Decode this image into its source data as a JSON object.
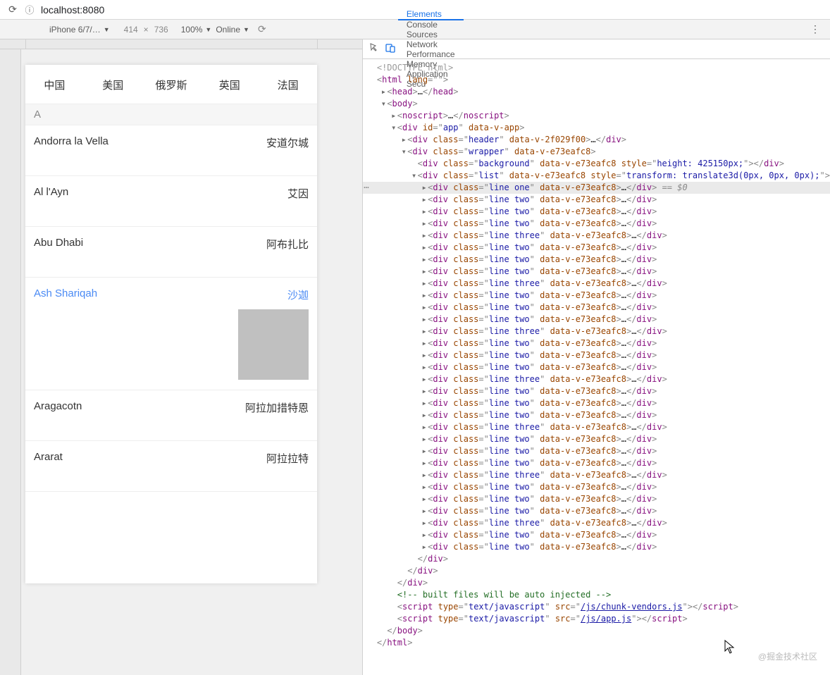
{
  "url": "localhost:8080",
  "device": {
    "name": "iPhone 6/7/…",
    "w": "414",
    "h": "736",
    "zoom": "100%",
    "online": "Online"
  },
  "dtTabs": [
    "Elements",
    "Console",
    "Sources",
    "Network",
    "Performance",
    "Memory",
    "Application",
    "Secu"
  ],
  "phone": {
    "tabs": [
      "中国",
      "美国",
      "俄罗斯",
      "英国",
      "法国"
    ],
    "section": "A",
    "rows": [
      {
        "en": "Andorra la Vella",
        "cn": "安道尔城"
      },
      {
        "en": "Al l'Ayn",
        "cn": "艾因"
      },
      {
        "en": "Abu Dhabi",
        "cn": "阿布扎比"
      },
      {
        "en": "Ash Shariqah",
        "cn": "沙迦",
        "active": true
      },
      {
        "en": "Aragacotn",
        "cn": "阿拉加措特恩"
      },
      {
        "en": "Ararat",
        "cn": "阿拉拉特"
      }
    ]
  },
  "tree": [
    {
      "d": 0,
      "c": "",
      "raw": "doctype"
    },
    {
      "d": 0,
      "c": "",
      "open": "html",
      "attrs": [
        [
          "lang",
          ""
        ]
      ],
      "selfc": false,
      "noKids": true
    },
    {
      "d": 1,
      "c": "▸",
      "open": "head",
      "dots": true,
      "close": "head"
    },
    {
      "d": 1,
      "c": "▾",
      "open": "body"
    },
    {
      "d": 2,
      "c": "▸",
      "open": "noscript",
      "dots": true,
      "close": "noscript"
    },
    {
      "d": 2,
      "c": "▾",
      "open": "div",
      "attrs": [
        [
          "id",
          "app"
        ],
        [
          "data-v-app",
          null
        ]
      ]
    },
    {
      "d": 3,
      "c": "▸",
      "open": "div",
      "attrs": [
        [
          "class",
          "header"
        ],
        [
          "data-v-2f029f00",
          null
        ]
      ],
      "dots": true,
      "close": "div"
    },
    {
      "d": 3,
      "c": "▾",
      "open": "div",
      "attrs": [
        [
          "class",
          "wrapper"
        ],
        [
          "data-v-e73eafc8",
          null
        ]
      ]
    },
    {
      "d": 4,
      "c": "",
      "open": "div",
      "attrs": [
        [
          "class",
          "background"
        ],
        [
          "data-v-e73eafc8",
          null
        ],
        [
          "style",
          "height: 425150px;"
        ]
      ],
      "close": "div"
    },
    {
      "d": 4,
      "c": "▾",
      "open": "div",
      "attrs": [
        [
          "class",
          "list"
        ],
        [
          "data-v-e73eafc8",
          null
        ],
        [
          "style",
          "transform: translate3d(0px, 0px, 0px);"
        ]
      ]
    },
    {
      "d": 5,
      "c": "▸",
      "hl": true,
      "open": "div",
      "attrs": [
        [
          "class",
          "line one"
        ],
        [
          "data-v-e73eafc8",
          null
        ]
      ],
      "dots": true,
      "close": "div",
      "sel": " == $0"
    },
    {
      "d": 5,
      "c": "▸",
      "open": "div",
      "attrs": [
        [
          "class",
          "line two"
        ],
        [
          "data-v-e73eafc8",
          null
        ]
      ],
      "dots": true,
      "close": "div"
    },
    {
      "d": 5,
      "c": "▸",
      "open": "div",
      "attrs": [
        [
          "class",
          "line two"
        ],
        [
          "data-v-e73eafc8",
          null
        ]
      ],
      "dots": true,
      "close": "div"
    },
    {
      "d": 5,
      "c": "▸",
      "open": "div",
      "attrs": [
        [
          "class",
          "line two"
        ],
        [
          "data-v-e73eafc8",
          null
        ]
      ],
      "dots": true,
      "close": "div"
    },
    {
      "d": 5,
      "c": "▸",
      "open": "div",
      "attrs": [
        [
          "class",
          "line three"
        ],
        [
          "data-v-e73eafc8",
          null
        ]
      ],
      "dots": true,
      "close": "div"
    },
    {
      "d": 5,
      "c": "▸",
      "open": "div",
      "attrs": [
        [
          "class",
          "line two"
        ],
        [
          "data-v-e73eafc8",
          null
        ]
      ],
      "dots": true,
      "close": "div"
    },
    {
      "d": 5,
      "c": "▸",
      "open": "div",
      "attrs": [
        [
          "class",
          "line two"
        ],
        [
          "data-v-e73eafc8",
          null
        ]
      ],
      "dots": true,
      "close": "div"
    },
    {
      "d": 5,
      "c": "▸",
      "open": "div",
      "attrs": [
        [
          "class",
          "line two"
        ],
        [
          "data-v-e73eafc8",
          null
        ]
      ],
      "dots": true,
      "close": "div"
    },
    {
      "d": 5,
      "c": "▸",
      "open": "div",
      "attrs": [
        [
          "class",
          "line three"
        ],
        [
          "data-v-e73eafc8",
          null
        ]
      ],
      "dots": true,
      "close": "div"
    },
    {
      "d": 5,
      "c": "▸",
      "open": "div",
      "attrs": [
        [
          "class",
          "line two"
        ],
        [
          "data-v-e73eafc8",
          null
        ]
      ],
      "dots": true,
      "close": "div"
    },
    {
      "d": 5,
      "c": "▸",
      "open": "div",
      "attrs": [
        [
          "class",
          "line two"
        ],
        [
          "data-v-e73eafc8",
          null
        ]
      ],
      "dots": true,
      "close": "div"
    },
    {
      "d": 5,
      "c": "▸",
      "open": "div",
      "attrs": [
        [
          "class",
          "line two"
        ],
        [
          "data-v-e73eafc8",
          null
        ]
      ],
      "dots": true,
      "close": "div"
    },
    {
      "d": 5,
      "c": "▸",
      "open": "div",
      "attrs": [
        [
          "class",
          "line three"
        ],
        [
          "data-v-e73eafc8",
          null
        ]
      ],
      "dots": true,
      "close": "div"
    },
    {
      "d": 5,
      "c": "▸",
      "open": "div",
      "attrs": [
        [
          "class",
          "line two"
        ],
        [
          "data-v-e73eafc8",
          null
        ]
      ],
      "dots": true,
      "close": "div"
    },
    {
      "d": 5,
      "c": "▸",
      "open": "div",
      "attrs": [
        [
          "class",
          "line two"
        ],
        [
          "data-v-e73eafc8",
          null
        ]
      ],
      "dots": true,
      "close": "div"
    },
    {
      "d": 5,
      "c": "▸",
      "open": "div",
      "attrs": [
        [
          "class",
          "line two"
        ],
        [
          "data-v-e73eafc8",
          null
        ]
      ],
      "dots": true,
      "close": "div"
    },
    {
      "d": 5,
      "c": "▸",
      "open": "div",
      "attrs": [
        [
          "class",
          "line three"
        ],
        [
          "data-v-e73eafc8",
          null
        ]
      ],
      "dots": true,
      "close": "div"
    },
    {
      "d": 5,
      "c": "▸",
      "open": "div",
      "attrs": [
        [
          "class",
          "line two"
        ],
        [
          "data-v-e73eafc8",
          null
        ]
      ],
      "dots": true,
      "close": "div"
    },
    {
      "d": 5,
      "c": "▸",
      "open": "div",
      "attrs": [
        [
          "class",
          "line two"
        ],
        [
          "data-v-e73eafc8",
          null
        ]
      ],
      "dots": true,
      "close": "div"
    },
    {
      "d": 5,
      "c": "▸",
      "open": "div",
      "attrs": [
        [
          "class",
          "line two"
        ],
        [
          "data-v-e73eafc8",
          null
        ]
      ],
      "dots": true,
      "close": "div"
    },
    {
      "d": 5,
      "c": "▸",
      "open": "div",
      "attrs": [
        [
          "class",
          "line three"
        ],
        [
          "data-v-e73eafc8",
          null
        ]
      ],
      "dots": true,
      "close": "div"
    },
    {
      "d": 5,
      "c": "▸",
      "open": "div",
      "attrs": [
        [
          "class",
          "line two"
        ],
        [
          "data-v-e73eafc8",
          null
        ]
      ],
      "dots": true,
      "close": "div"
    },
    {
      "d": 5,
      "c": "▸",
      "open": "div",
      "attrs": [
        [
          "class",
          "line two"
        ],
        [
          "data-v-e73eafc8",
          null
        ]
      ],
      "dots": true,
      "close": "div"
    },
    {
      "d": 5,
      "c": "▸",
      "open": "div",
      "attrs": [
        [
          "class",
          "line two"
        ],
        [
          "data-v-e73eafc8",
          null
        ]
      ],
      "dots": true,
      "close": "div"
    },
    {
      "d": 5,
      "c": "▸",
      "open": "div",
      "attrs": [
        [
          "class",
          "line three"
        ],
        [
          "data-v-e73eafc8",
          null
        ]
      ],
      "dots": true,
      "close": "div"
    },
    {
      "d": 5,
      "c": "▸",
      "open": "div",
      "attrs": [
        [
          "class",
          "line two"
        ],
        [
          "data-v-e73eafc8",
          null
        ]
      ],
      "dots": true,
      "close": "div"
    },
    {
      "d": 5,
      "c": "▸",
      "open": "div",
      "attrs": [
        [
          "class",
          "line two"
        ],
        [
          "data-v-e73eafc8",
          null
        ]
      ],
      "dots": true,
      "close": "div"
    },
    {
      "d": 5,
      "c": "▸",
      "open": "div",
      "attrs": [
        [
          "class",
          "line two"
        ],
        [
          "data-v-e73eafc8",
          null
        ]
      ],
      "dots": true,
      "close": "div"
    },
    {
      "d": 5,
      "c": "▸",
      "open": "div",
      "attrs": [
        [
          "class",
          "line three"
        ],
        [
          "data-v-e73eafc8",
          null
        ]
      ],
      "dots": true,
      "close": "div"
    },
    {
      "d": 5,
      "c": "▸",
      "open": "div",
      "attrs": [
        [
          "class",
          "line two"
        ],
        [
          "data-v-e73eafc8",
          null
        ]
      ],
      "dots": true,
      "close": "div"
    },
    {
      "d": 5,
      "c": "▸",
      "open": "div",
      "attrs": [
        [
          "class",
          "line two"
        ],
        [
          "data-v-e73eafc8",
          null
        ]
      ],
      "dots": true,
      "close": "div"
    },
    {
      "d": 4,
      "c": "",
      "closeOnly": "div"
    },
    {
      "d": 3,
      "c": "",
      "closeOnly": "div"
    },
    {
      "d": 2,
      "c": "",
      "closeOnly": "div"
    },
    {
      "d": 2,
      "c": "",
      "comment": " built files will be auto injected "
    },
    {
      "d": 2,
      "c": "",
      "open": "script",
      "attrs": [
        [
          "type",
          "text/javascript"
        ],
        [
          "src",
          "/js/chunk-vendors.js"
        ]
      ],
      "linkAttr": "src",
      "close": "script"
    },
    {
      "d": 2,
      "c": "",
      "open": "script",
      "attrs": [
        [
          "type",
          "text/javascript"
        ],
        [
          "src",
          "/js/app.js"
        ]
      ],
      "linkAttr": "src",
      "close": "script"
    },
    {
      "d": 1,
      "c": "",
      "closeOnly": "body"
    },
    {
      "d": 0,
      "c": "",
      "closeOnly": "html"
    }
  ],
  "watermark": "@掘金技术社区"
}
